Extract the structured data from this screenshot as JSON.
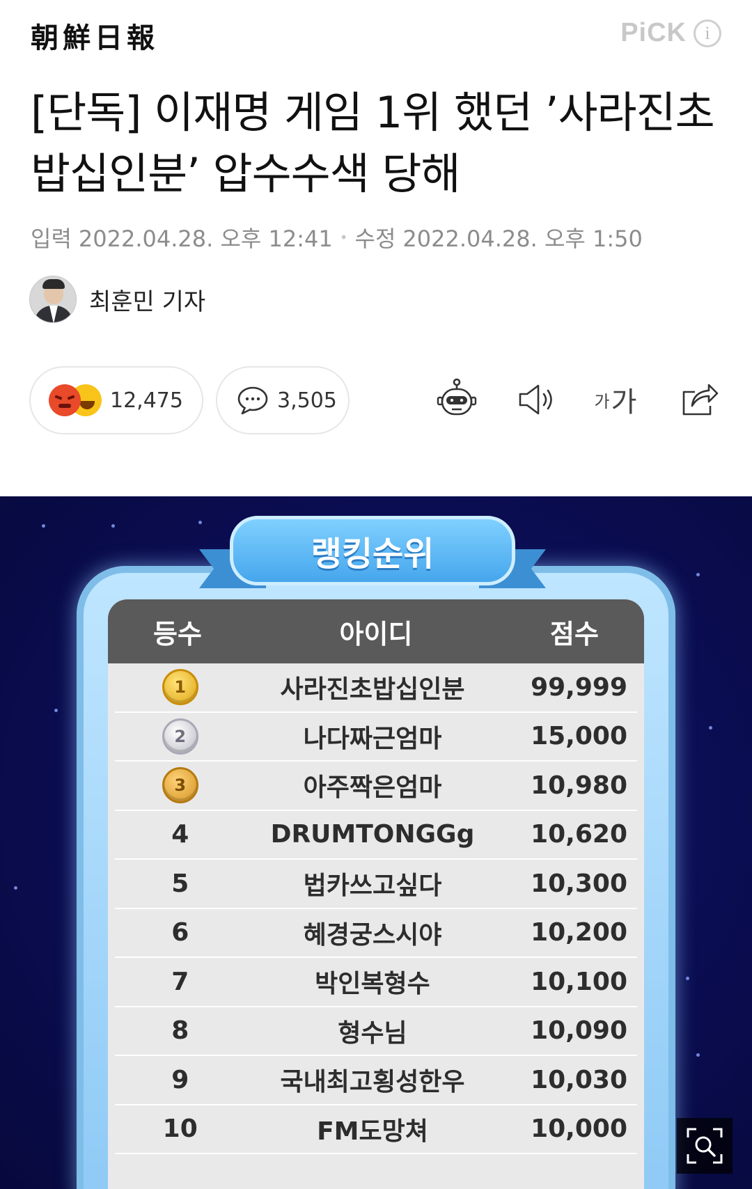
{
  "header": {
    "masthead": "朝鮮日報",
    "pick_label": "PiCK",
    "info_icon": "i"
  },
  "article": {
    "title": "[단독] 이재명 게임 1위 했던 ’사라진초밥십인분’ 압수수색 당해",
    "published_label": "입력",
    "published": "2022.04.28. 오후 12:41",
    "separator": "•",
    "updated_label": "수정",
    "updated": "2022.04.28. 오후 1:50",
    "reporter": "최훈민 기자"
  },
  "actions": {
    "reactions_count": "12,475",
    "comments_count": "3,505",
    "font_small": "가",
    "font_large": "가",
    "icons": [
      "angry-emoji-icon",
      "laugh-emoji-icon",
      "comment-icon",
      "bot-summary-icon",
      "speaker-icon",
      "font-size-icon",
      "share-icon"
    ]
  },
  "ranking": {
    "title": "랭킹순위",
    "headers": {
      "rank": "등수",
      "id": "아이디",
      "score": "점수"
    },
    "rows": [
      {
        "rank": "1",
        "medal": "gold",
        "id": "사라진초밥십인분",
        "score": "99,999"
      },
      {
        "rank": "2",
        "medal": "silver",
        "id": "나다짜근엄마",
        "score": "15,000"
      },
      {
        "rank": "3",
        "medal": "bronze",
        "id": "아주짝은엄마",
        "score": "10,980"
      },
      {
        "rank": "4",
        "id": "DRUMTONGGg",
        "score": "10,620"
      },
      {
        "rank": "5",
        "id": "법카쓰고싶다",
        "score": "10,300"
      },
      {
        "rank": "6",
        "id": "혜경궁스시야",
        "score": "10,200"
      },
      {
        "rank": "7",
        "id": "박인복형수",
        "score": "10,100"
      },
      {
        "rank": "8",
        "id": "형수님",
        "score": "10,090"
      },
      {
        "rank": "9",
        "id": "국내최고횡성한우",
        "score": "10,030"
      },
      {
        "rank": "10",
        "id": "FM도망쳐",
        "score": "10,000"
      }
    ]
  },
  "colors": {
    "background_night": "#0b0d52",
    "header_row": "#5a5a5a",
    "frame": "#8cc8f4",
    "ribbon": "#46a6ec",
    "angry": "#e84a2a",
    "laugh": "#f9c419"
  }
}
